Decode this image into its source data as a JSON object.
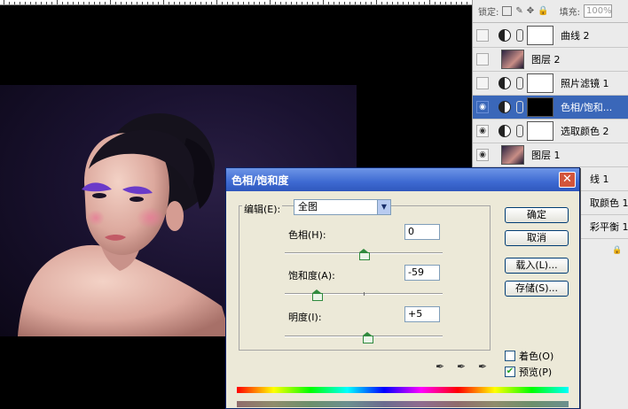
{
  "layers_panel": {
    "lock_label": "锁定:",
    "fill_label": "填充:",
    "fill_value": "100%",
    "layers": [
      {
        "name": "曲线 2",
        "type": "adjustment",
        "visible": false,
        "selected": false
      },
      {
        "name": "图层 2",
        "type": "image",
        "visible": false,
        "selected": false
      },
      {
        "name": "照片滤镜 1",
        "type": "adjustment",
        "visible": false,
        "selected": false
      },
      {
        "name": "色相/饱和...",
        "type": "adjustment",
        "visible": true,
        "selected": true
      },
      {
        "name": "选取颜色 2",
        "type": "adjustment",
        "visible": true,
        "selected": false
      },
      {
        "name": "图层 1",
        "type": "image",
        "visible": true,
        "selected": false
      },
      {
        "name": "线 1",
        "type": "partial",
        "visible": true,
        "selected": false
      },
      {
        "name": "取颜色 1",
        "type": "partial",
        "visible": true,
        "selected": false
      },
      {
        "name": "彩平衡 1",
        "type": "partial",
        "visible": true,
        "selected": false
      }
    ]
  },
  "dialog": {
    "title": "色相/饱和度",
    "close_icon": "close-icon",
    "edit_label": "编辑(E):",
    "edit_value": "全图",
    "hue": {
      "label": "色相(H):",
      "value": "0",
      "fraction": 0.5
    },
    "saturation": {
      "label": "饱和度(A):",
      "value": "-59",
      "fraction": 0.205
    },
    "lightness": {
      "label": "明度(I):",
      "value": "+5",
      "fraction": 0.525
    },
    "buttons": {
      "ok": "确定",
      "cancel": "取消",
      "load": "载入(L)...",
      "save": "存储(S)..."
    },
    "colorize_label": "着色(O)",
    "colorize_checked": false,
    "preview_label": "预览(P)",
    "preview_checked": true
  }
}
